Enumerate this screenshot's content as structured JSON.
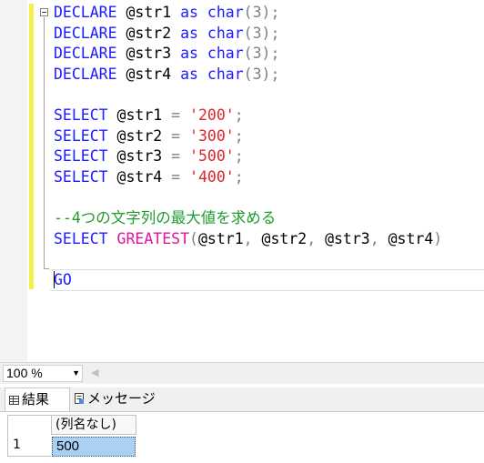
{
  "editor": {
    "lines": [
      [
        {
          "t": "DECLARE",
          "c": "kw"
        },
        {
          "t": " @str1 ",
          "c": ""
        },
        {
          "t": "as",
          "c": "kw"
        },
        {
          "t": " ",
          "c": ""
        },
        {
          "t": "char",
          "c": "kw"
        },
        {
          "t": "(3);",
          "c": "op"
        }
      ],
      [
        {
          "t": "DECLARE",
          "c": "kw"
        },
        {
          "t": " @str2 ",
          "c": ""
        },
        {
          "t": "as",
          "c": "kw"
        },
        {
          "t": " ",
          "c": ""
        },
        {
          "t": "char",
          "c": "kw"
        },
        {
          "t": "(3);",
          "c": "op"
        }
      ],
      [
        {
          "t": "DECLARE",
          "c": "kw"
        },
        {
          "t": " @str3 ",
          "c": ""
        },
        {
          "t": "as",
          "c": "kw"
        },
        {
          "t": " ",
          "c": ""
        },
        {
          "t": "char",
          "c": "kw"
        },
        {
          "t": "(3);",
          "c": "op"
        }
      ],
      [
        {
          "t": "DECLARE",
          "c": "kw"
        },
        {
          "t": " @str4 ",
          "c": ""
        },
        {
          "t": "as",
          "c": "kw"
        },
        {
          "t": " ",
          "c": ""
        },
        {
          "t": "char",
          "c": "kw"
        },
        {
          "t": "(3);",
          "c": "op"
        }
      ],
      [],
      [
        {
          "t": "SELECT",
          "c": "kw"
        },
        {
          "t": " @str1 ",
          "c": ""
        },
        {
          "t": "=",
          "c": "op"
        },
        {
          "t": " ",
          "c": ""
        },
        {
          "t": "'200'",
          "c": "str"
        },
        {
          "t": ";",
          "c": "op"
        }
      ],
      [
        {
          "t": "SELECT",
          "c": "kw"
        },
        {
          "t": " @str2 ",
          "c": ""
        },
        {
          "t": "=",
          "c": "op"
        },
        {
          "t": " ",
          "c": ""
        },
        {
          "t": "'300'",
          "c": "str"
        },
        {
          "t": ";",
          "c": "op"
        }
      ],
      [
        {
          "t": "SELECT",
          "c": "kw"
        },
        {
          "t": " @str3 ",
          "c": ""
        },
        {
          "t": "=",
          "c": "op"
        },
        {
          "t": " ",
          "c": ""
        },
        {
          "t": "'500'",
          "c": "str"
        },
        {
          "t": ";",
          "c": "op"
        }
      ],
      [
        {
          "t": "SELECT",
          "c": "kw"
        },
        {
          "t": " @str4 ",
          "c": ""
        },
        {
          "t": "=",
          "c": "op"
        },
        {
          "t": " ",
          "c": ""
        },
        {
          "t": "'400'",
          "c": "str"
        },
        {
          "t": ";",
          "c": "op"
        }
      ],
      [],
      [
        {
          "t": "--4つの文字列の最大値を求める",
          "c": "cm"
        }
      ],
      [
        {
          "t": "SELECT",
          "c": "kw"
        },
        {
          "t": " ",
          "c": ""
        },
        {
          "t": "GREATEST",
          "c": "fn"
        },
        {
          "t": "(",
          "c": "op"
        },
        {
          "t": "@str1",
          "c": ""
        },
        {
          "t": ", ",
          "c": "op"
        },
        {
          "t": "@str2",
          "c": ""
        },
        {
          "t": ", ",
          "c": "op"
        },
        {
          "t": "@str3",
          "c": ""
        },
        {
          "t": ", ",
          "c": "op"
        },
        {
          "t": "@str4",
          "c": ""
        },
        {
          "t": ")",
          "c": "op"
        }
      ],
      [],
      [
        {
          "t": "GO",
          "c": "kw"
        }
      ]
    ]
  },
  "zoom": {
    "level": "100 %"
  },
  "results": {
    "tabs": [
      {
        "label": "結果",
        "icon": "grid-icon",
        "active": true
      },
      {
        "label": "メッセージ",
        "icon": "messages-icon",
        "active": false
      }
    ],
    "grid": {
      "columns": [
        "(列名なし)"
      ],
      "rows": [
        {
          "row_number": "1",
          "cells": [
            "500"
          ]
        }
      ]
    }
  },
  "colors": {
    "keyword": "#1c1cff",
    "function": "#e0159e",
    "string": "#e0242b",
    "comment": "#1f9c2d",
    "operator": "#808080",
    "change_bar": "#f1ef4c",
    "selected_cell": "#a9d1f5"
  }
}
